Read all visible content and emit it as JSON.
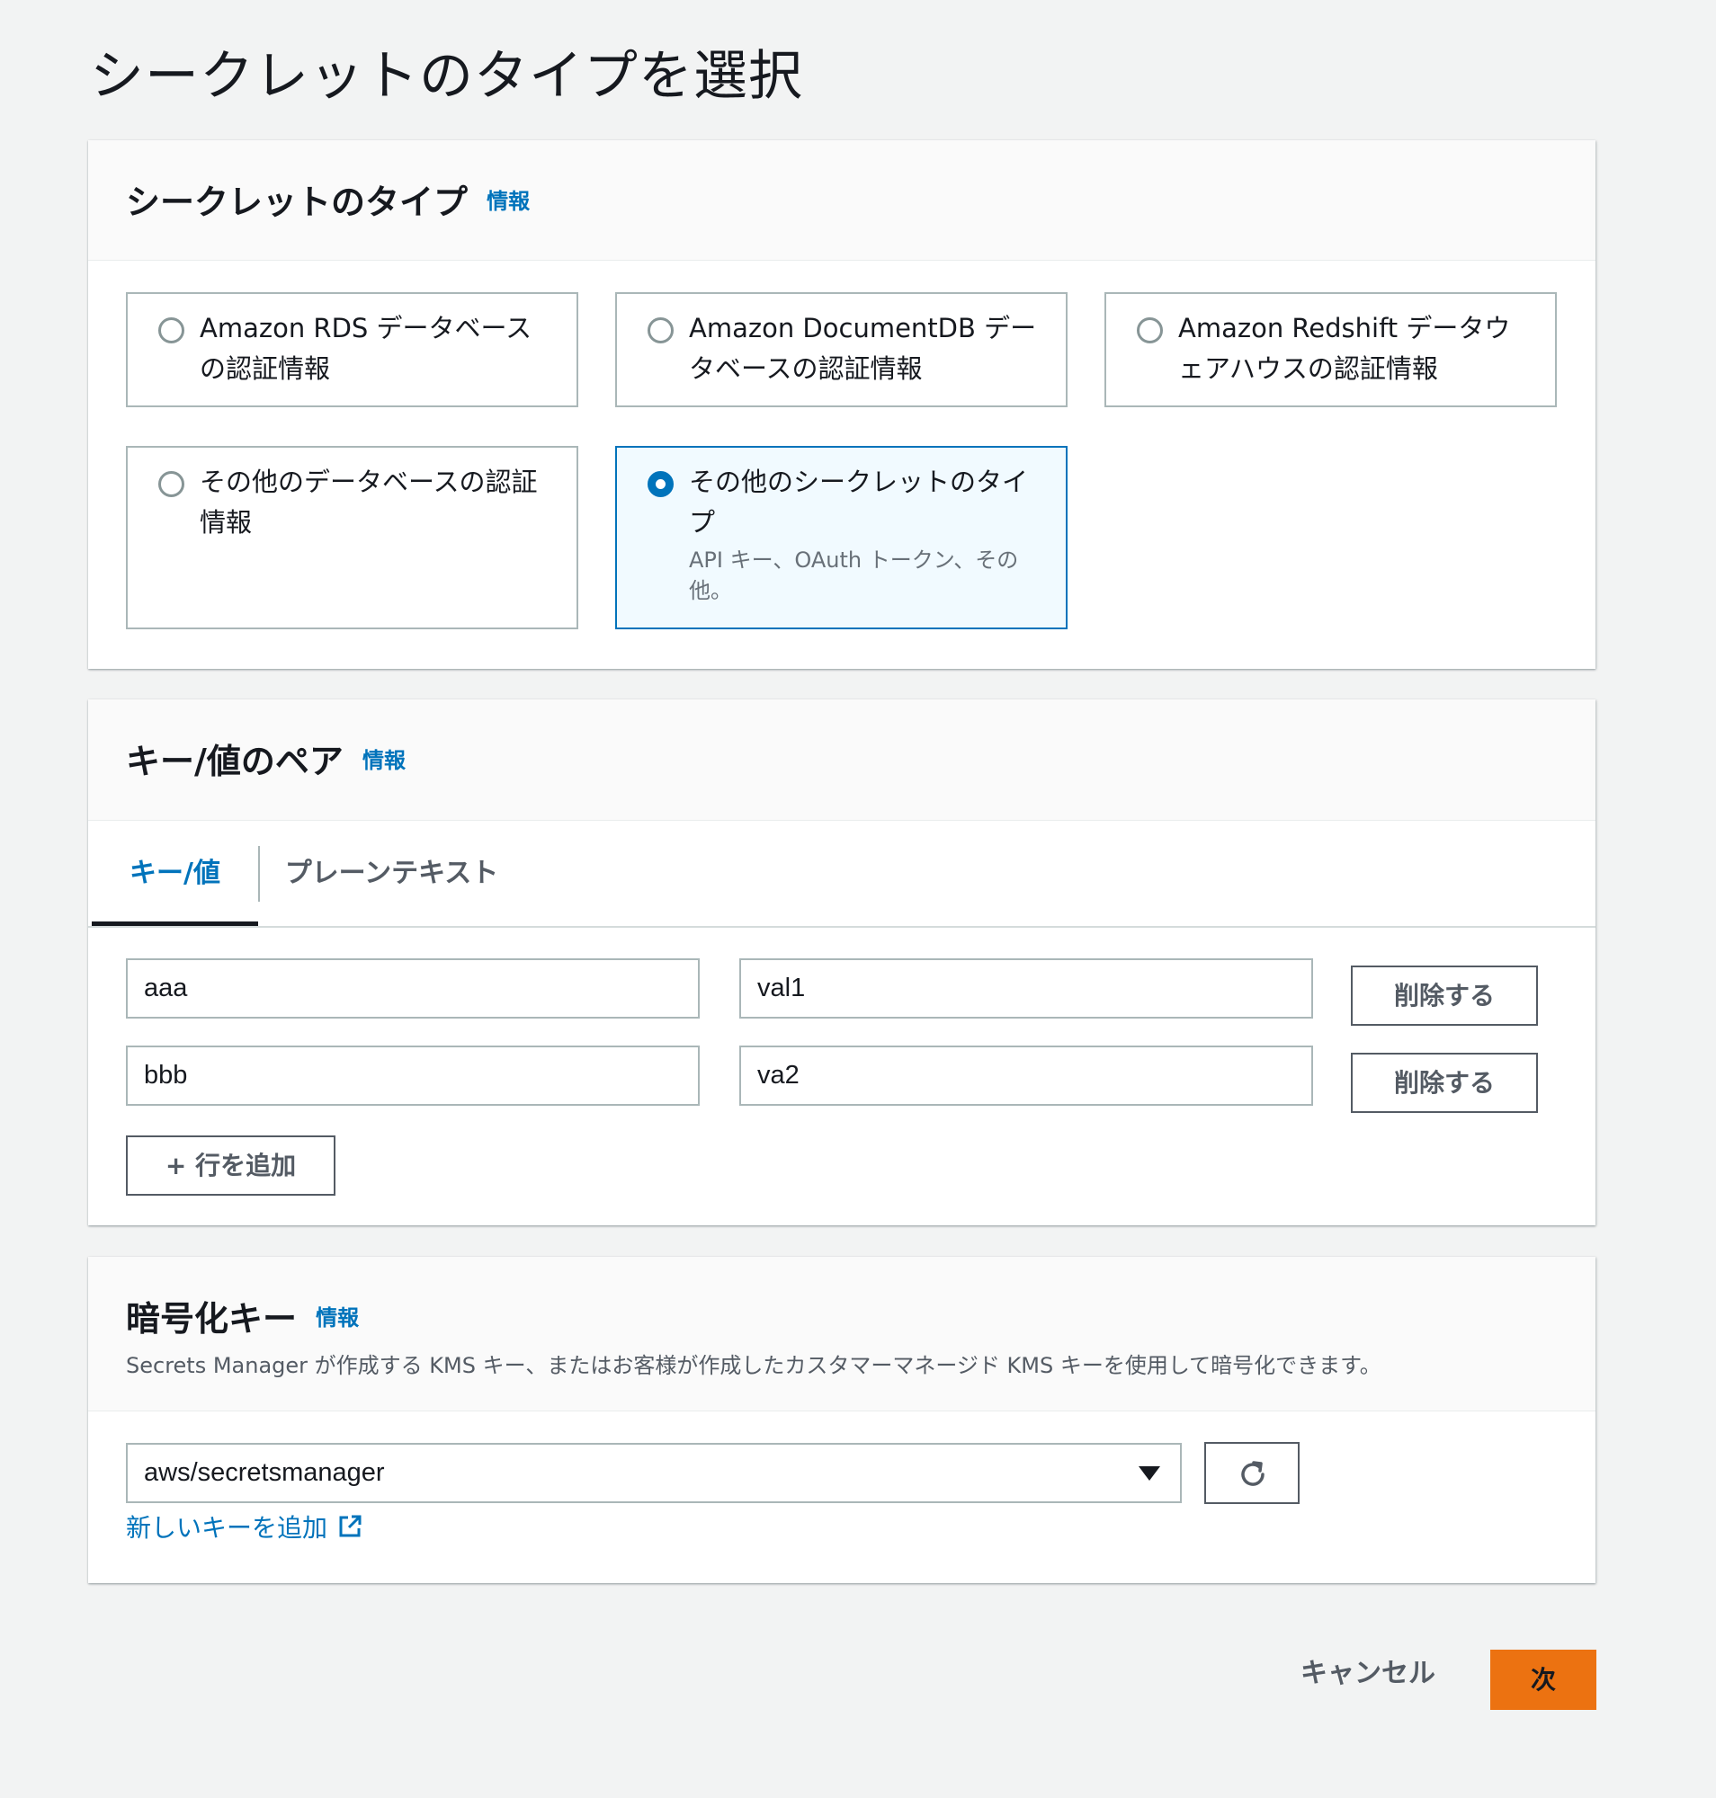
{
  "page": {
    "title": "シークレットのタイプを選択"
  },
  "secret_type": {
    "title": "シークレットのタイプ",
    "info": "情報",
    "options": [
      {
        "label": "Amazon RDS データベースの認証情報",
        "selected": false
      },
      {
        "label": "Amazon DocumentDB データベースの認証情報",
        "selected": false
      },
      {
        "label": "Amazon Redshift データウェアハウスの認証情報",
        "selected": false
      },
      {
        "label": "その他のデータベースの認証情報",
        "selected": false
      },
      {
        "label": "その他のシークレットのタイプ",
        "description": "API キー、OAuth トークン、その他。",
        "selected": true
      }
    ]
  },
  "kv_pairs": {
    "title": "キー/値のペア",
    "info": "情報",
    "tabs": [
      {
        "label": "キー/値",
        "active": true
      },
      {
        "label": "プレーンテキスト",
        "active": false
      }
    ],
    "rows": [
      {
        "key": "aaa",
        "value": "val1",
        "remove_label": "削除する"
      },
      {
        "key": "bbb",
        "value": "va2",
        "remove_label": "削除する"
      }
    ],
    "add_row_label": "+ 行を追加"
  },
  "encryption": {
    "title": "暗号化キー",
    "info": "情報",
    "description": "Secrets Manager が作成する KMS キー、またはお客様が作成したカスタマーマネージド KMS キーを使用して暗号化できます。",
    "selected_key": "aws/secretsmanager",
    "add_key_link": "新しいキーを追加"
  },
  "footer": {
    "cancel_label": "キャンセル",
    "next_label": "次"
  },
  "colors": {
    "accent": "#0073bb",
    "primary_button": "#ec7211",
    "background": "#f2f3f3"
  },
  "icons": [
    "radio-icon",
    "chevron-down-icon",
    "refresh-icon",
    "external-link-icon"
  ]
}
